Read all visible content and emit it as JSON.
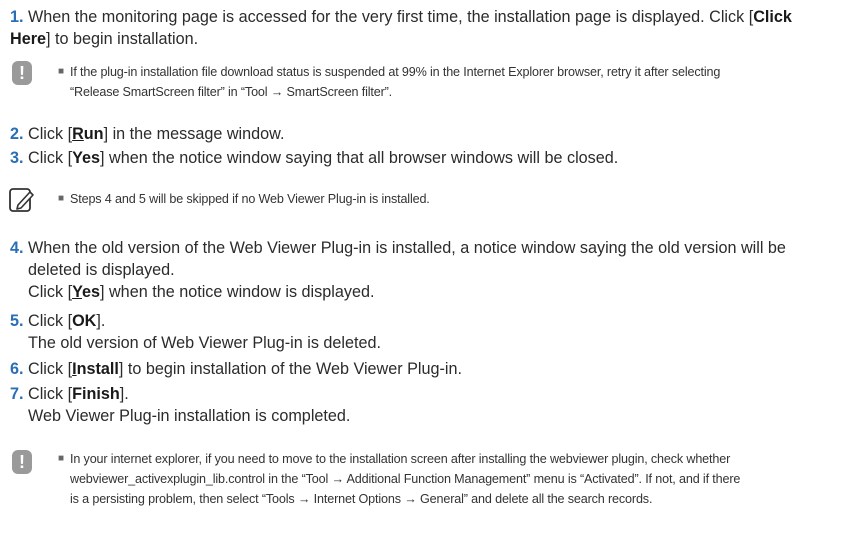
{
  "step1": {
    "num": "1.",
    "text_a": "When the monitoring page is accessed for the very first time, the installation page is displayed. Click [",
    "btn": "Click Here",
    "text_b": "] to begin installation."
  },
  "note1": {
    "line1": "If the plug-in installation file download status is suspended at 99% in the Internet Explorer browser, retry it after selecting",
    "line2": "“Release SmartScreen filter” in “Tool → SmartScreen filter”."
  },
  "step2": {
    "num": "2.",
    "a": "Click [",
    "btn_first": "R",
    "btn_rest": "un",
    "b": "] in the message window."
  },
  "step3": {
    "num": "3.",
    "a": "Click [",
    "btn": "Yes",
    "b": "] when the notice window saying that all browser windows will be closed."
  },
  "note2": {
    "text": "Steps 4 and 5 will be skipped if no Web Viewer Plug-in is installed."
  },
  "step4": {
    "num": "4.",
    "line1": "When the old version of the Web Viewer Plug-in is installed, a notice window saying the old version will be",
    "line2": "deleted is displayed.",
    "line3_a": "Click [",
    "line3_btn_first": "Y",
    "line3_btn_rest": "es",
    "line3_b": "] when the notice window is displayed."
  },
  "step5": {
    "num": "5.",
    "a": "Click [",
    "btn": "OK",
    "b": "].",
    "line2": "The old version of Web Viewer Plug-in is deleted."
  },
  "step6": {
    "num": "6.",
    "a": "Click [",
    "btn_first": "I",
    "btn_rest": "nstall",
    "b": "] to begin installation of the Web Viewer Plug-in."
  },
  "step7": {
    "num": "7.",
    "a": "Click [",
    "btn": "Finish",
    "b": "].",
    "line2": "Web Viewer Plug-in installation is completed."
  },
  "note3": {
    "line1": "In your internet explorer, if you need to move to the installation screen after installing the webviewer plugin, check whether",
    "line2": "webviewer_activexplugin_lib.control in the “Tool → Additional Function Management” menu is “Activated”. If not, and if there",
    "line3": "is a persisting problem, then select “Tools → Internet Options → General” and delete all the search records."
  },
  "icons": {
    "warning": "exclamation-icon",
    "memo": "memo-pencil-icon",
    "bullet": "■"
  }
}
